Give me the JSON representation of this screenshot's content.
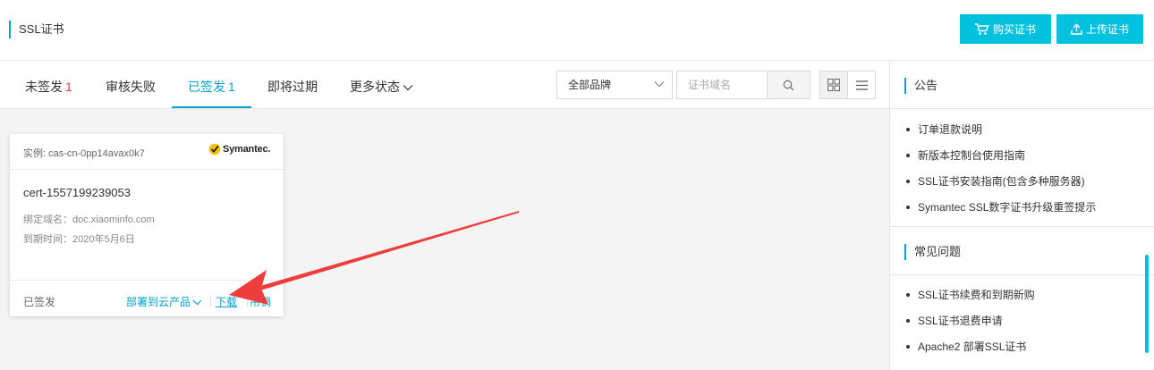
{
  "header": {
    "title": "SSL证书",
    "buy_label": "购买证书",
    "upload_label": "上传证书"
  },
  "tabs": [
    {
      "label": "未签发",
      "count": "1"
    },
    {
      "label": "审核失败",
      "count": ""
    },
    {
      "label": "已签发",
      "count": "1"
    },
    {
      "label": "即将过期",
      "count": ""
    },
    {
      "label": "更多状态",
      "count": ""
    }
  ],
  "filters": {
    "brand_selected": "全部品牌",
    "domain_placeholder": "证书域名"
  },
  "card": {
    "instance": "实例: cas-cn-0pp14avax0k7",
    "brand": "Symantec.",
    "cert_name": "cert-1557199239053",
    "domain_label": "绑定域名：",
    "domain_value": "doc.xiaominfo.com",
    "expire_label": "到期时间：",
    "expire_value": "2020年5月6日",
    "status": "已签发",
    "deploy_label": "部署到云产品",
    "download_label": "下载",
    "revoke_label": "吊销"
  },
  "aside": {
    "notice_title": "公告",
    "notices": [
      "订单退款说明",
      "新版本控制台使用指南",
      "SSL证书安装指南(包含多种服务器)",
      "Symantec SSL数字证书升级重签提示"
    ],
    "faq_title": "常见问题",
    "faqs": [
      "SSL证书续费和到期新购",
      "SSL证书退费申请",
      "Apache2 部署SSL证书"
    ]
  },
  "colors": {
    "accent": "#00a2ca",
    "button": "#00c1de",
    "count_red": "#e4393c",
    "annotation_arrow": "#ef3d3d"
  }
}
